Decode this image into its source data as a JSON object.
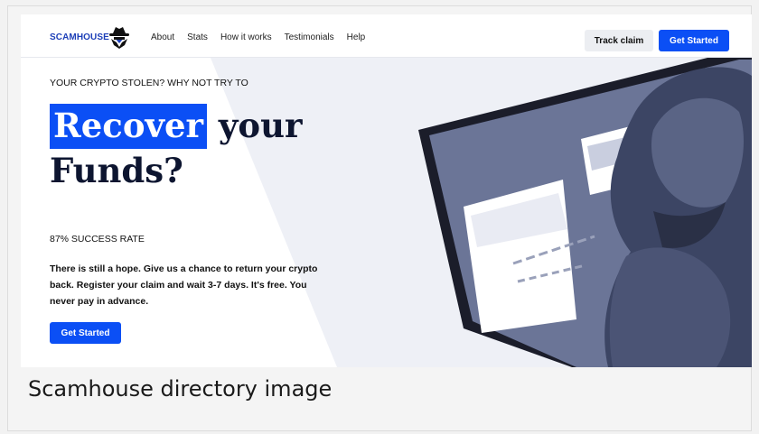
{
  "nav": {
    "logo": "SCAMHOUSE",
    "links": [
      "About",
      "Stats",
      "How it works",
      "Testimonials",
      "Help"
    ],
    "track_claim": "Track claim",
    "get_started": "Get Started"
  },
  "hero": {
    "eyebrow": "YOUR CRYPTO STOLEN? WHY NOT TRY TO",
    "headline_highlight": "Recover",
    "headline_rest_1": " your",
    "headline_rest_2": "Funds?",
    "success_rate": "87% SUCCESS RATE",
    "description": "There is still a hope. Give us a chance to return your crypto back. Register your claim and wait 3-7 days. It's free. You never pay in advance.",
    "cta": "Get Started"
  },
  "caption": "Scamhouse directory image",
  "colors": {
    "accent": "#0b4ff5",
    "logo": "#1d3fb8",
    "headline": "#0d1530"
  },
  "icons": {
    "logo": "hacker-hat-icon",
    "illustration": "hooded-hacker-laptop-illustration"
  }
}
